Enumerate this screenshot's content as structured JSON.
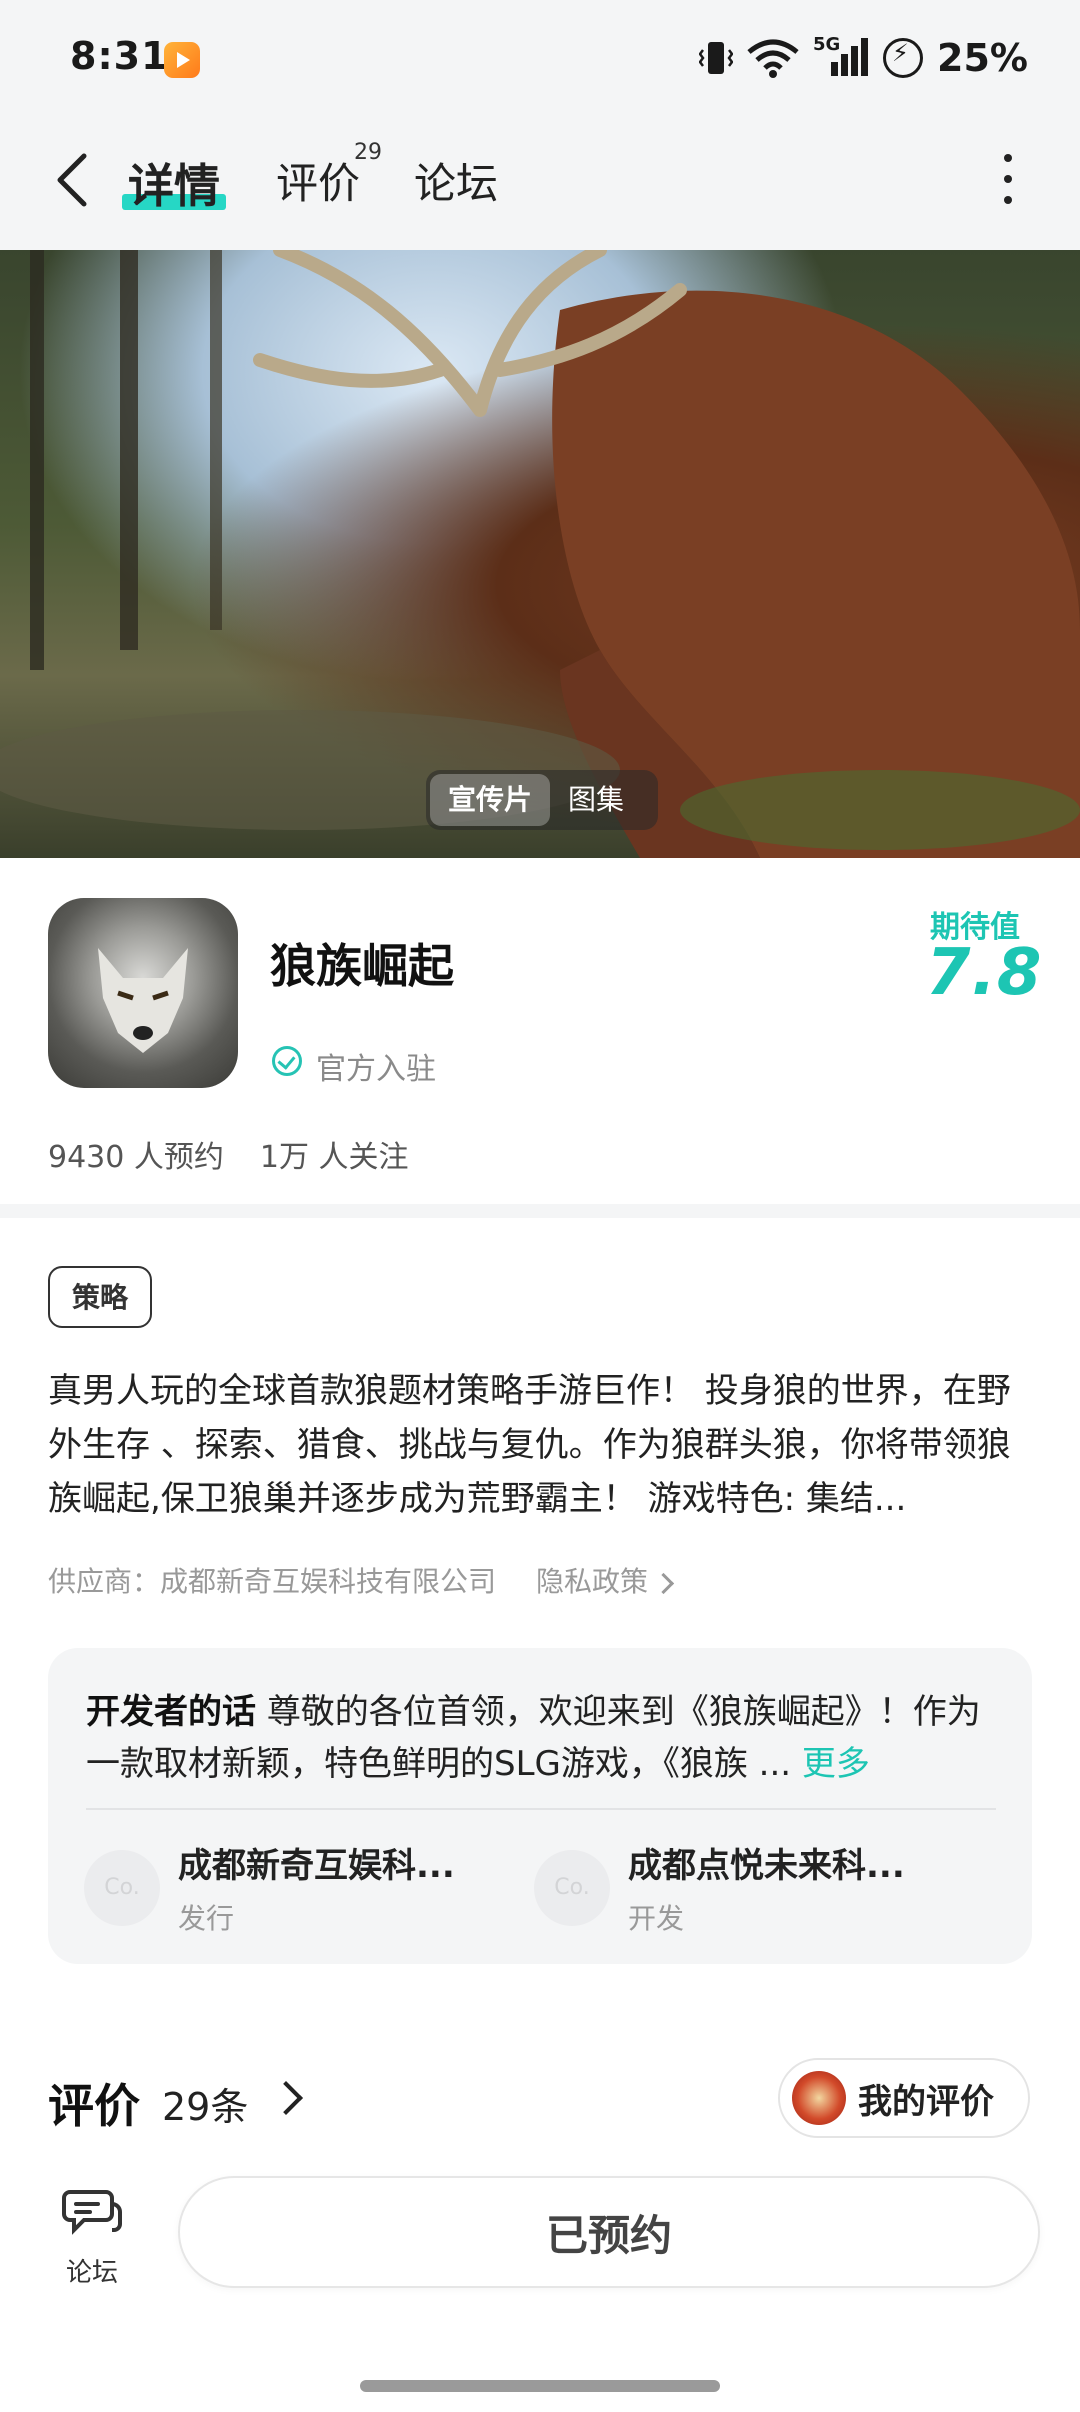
{
  "status_bar": {
    "time": "8:31",
    "network": "5G",
    "battery": "25%",
    "icons": [
      "app-badge-icon",
      "vibrate-icon",
      "wifi-icon",
      "signal-icon",
      "battery-charging-icon"
    ]
  },
  "nav": {
    "tabs": [
      {
        "label": "详情",
        "active": true
      },
      {
        "label": "评价",
        "badge": "29"
      },
      {
        "label": "论坛"
      }
    ],
    "accent_color": "#26d7c5"
  },
  "hero": {
    "media_tabs": [
      {
        "label": "宣传片",
        "active": true
      },
      {
        "label": "图集"
      }
    ]
  },
  "game": {
    "title": "狼族崛起",
    "official_label": "官方入驻",
    "expect_label": "期待值",
    "expect_value": "7.8",
    "reservations": "9430 人预约",
    "followers": "1万 人关注",
    "tag": "策略",
    "description": "真男人玩的全球首款狼题材策略手游巨作！ 投身狼的世界，在野外生存 、探索、猎食、挑战与复仇。作为狼群头狼，你将带领狼族崛起,保卫狼巢并逐步成为荒野霸主！ 游戏特色: 集结...",
    "supplier": "供应商：成都新奇互娱科技有限公司",
    "privacy_label": "隐私政策"
  },
  "developer": {
    "heading": "开发者的话",
    "text": "尊敬的各位首领，欢迎来到《狼族崛起》！作为一款取材新颖，特色鲜明的SLG游戏，《狼族 ...",
    "more_label": "更多",
    "companies": [
      {
        "avatar": "Co.",
        "name": "成都新奇互娱科...",
        "role": "发行"
      },
      {
        "avatar": "Co.",
        "name": "成都点悦未来科...",
        "role": "开发"
      }
    ]
  },
  "reviews": {
    "title": "评价",
    "count": "29条",
    "my_review_label": "我的评价"
  },
  "bottom_bar": {
    "forum_label": "论坛",
    "action_label": "已预约"
  }
}
